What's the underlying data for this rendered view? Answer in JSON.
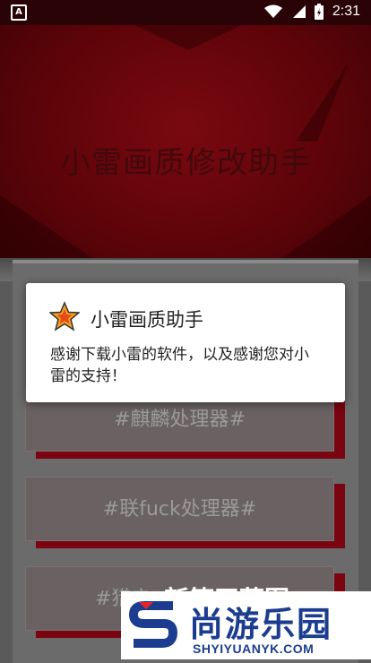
{
  "status_bar": {
    "time": "2:31"
  },
  "hero": {
    "title": "小雷画质修改助手"
  },
  "cards": [
    {
      "label": "#麒麟处理器#"
    },
    {
      "label": "#联fuck处理器#"
    },
    {
      "label": "#猎户"
    }
  ],
  "dialog": {
    "title": "小雷画质助手",
    "message": "感谢下载小雷的软件，以及感谢您对小雷的支持！"
  },
  "watermark": {
    "name": "尚游乐园",
    "url": "SHYIYUANYK.COM",
    "behind_text": "新箍天蒲图"
  },
  "colors": {
    "accent": "#7a0410",
    "brand_blue": "#1c3d8f"
  }
}
